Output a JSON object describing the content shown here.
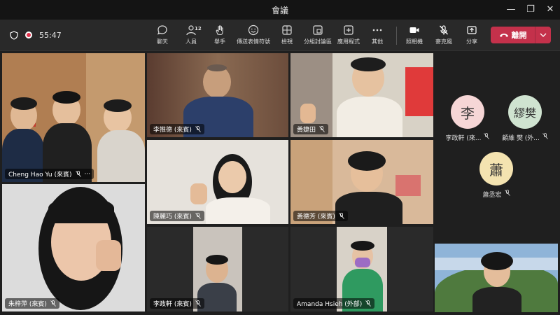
{
  "window": {
    "title": "會議",
    "minimize": "—",
    "maximize": "❐",
    "close": "✕"
  },
  "status": {
    "timer": "55:47"
  },
  "toolbar": {
    "chat": "聊天",
    "people": "人員",
    "people_count": "12",
    "raise": "舉手",
    "react": "傳送表情符號",
    "view": "檢視",
    "rooms": "分組討論區",
    "apps": "應用程式",
    "more": "其他",
    "camera": "照相機",
    "mic": "麥克風",
    "share": "分享",
    "leave": "離開"
  },
  "participants": [
    {
      "name": "Cheng Hao Yu (來賓)",
      "more": "···"
    },
    {
      "name": "李推德 (來賓)"
    },
    {
      "name": "黃婕田"
    },
    {
      "name": "陳麗巧 (來賓)"
    },
    {
      "name": "黃德芳 (來賓)"
    },
    {
      "name": "朱梓萍 (來賓)"
    },
    {
      "name": "李政軒 (來賓)"
    },
    {
      "name": "Amanda Hsieh (外部)"
    }
  ],
  "avatars": [
    {
      "initial": "李",
      "label": "李政軒 (來...",
      "color": "#f6d6d6"
    },
    {
      "initial": "繆樊",
      "label": "顧維 樊 (外...",
      "color": "#cfe3d0"
    },
    {
      "initial": "蕭",
      "label": "蕭丞宏",
      "color": "#f4e3b0"
    }
  ],
  "icons": {
    "mic_off": "mic-off-icon"
  }
}
